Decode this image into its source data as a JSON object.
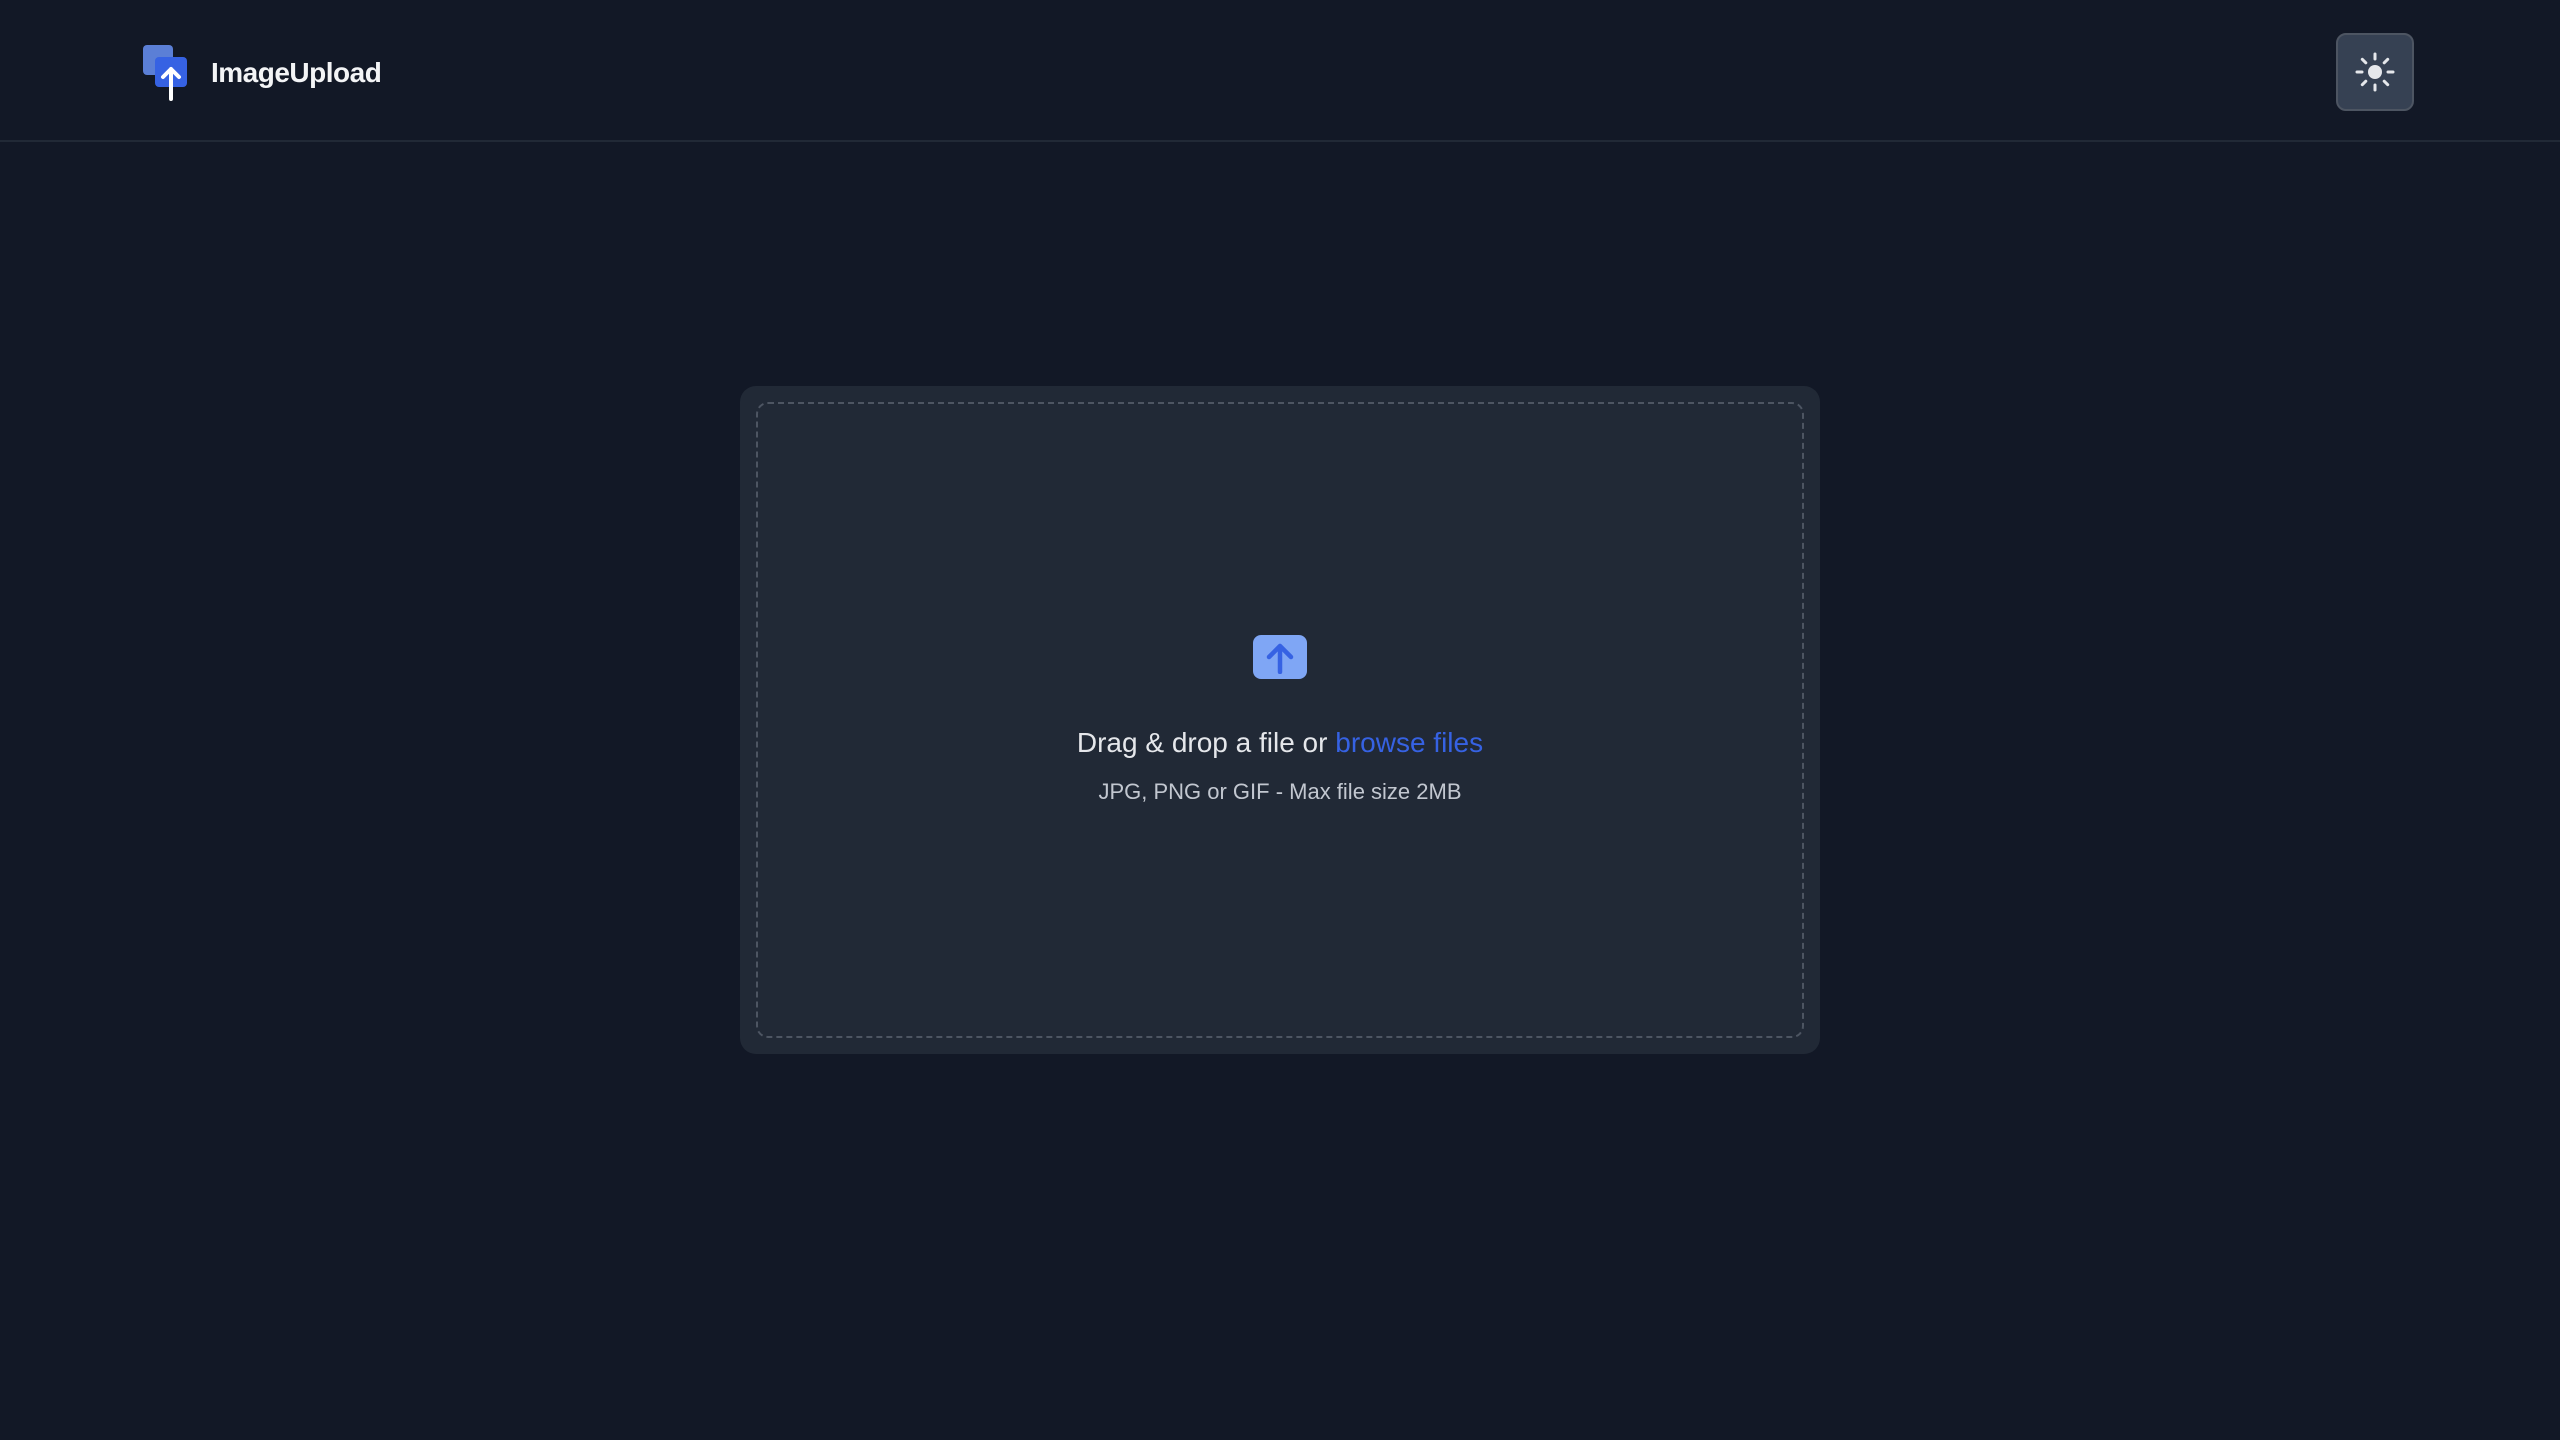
{
  "header": {
    "app_name": "ImageUpload",
    "logo_icon": "image-upload-logo-icon",
    "theme_toggle_icon": "sun-icon"
  },
  "upload": {
    "icon": "upload-arrow-icon",
    "prompt_text": "Drag & drop a file or",
    "browse_label": "browse files",
    "hint": "JPG, PNG or GIF - Max file size 2MB"
  },
  "colors": {
    "background": "#121826",
    "card": "#212936",
    "accent": "#3662e3",
    "accent_light": "#7fa6f5"
  }
}
